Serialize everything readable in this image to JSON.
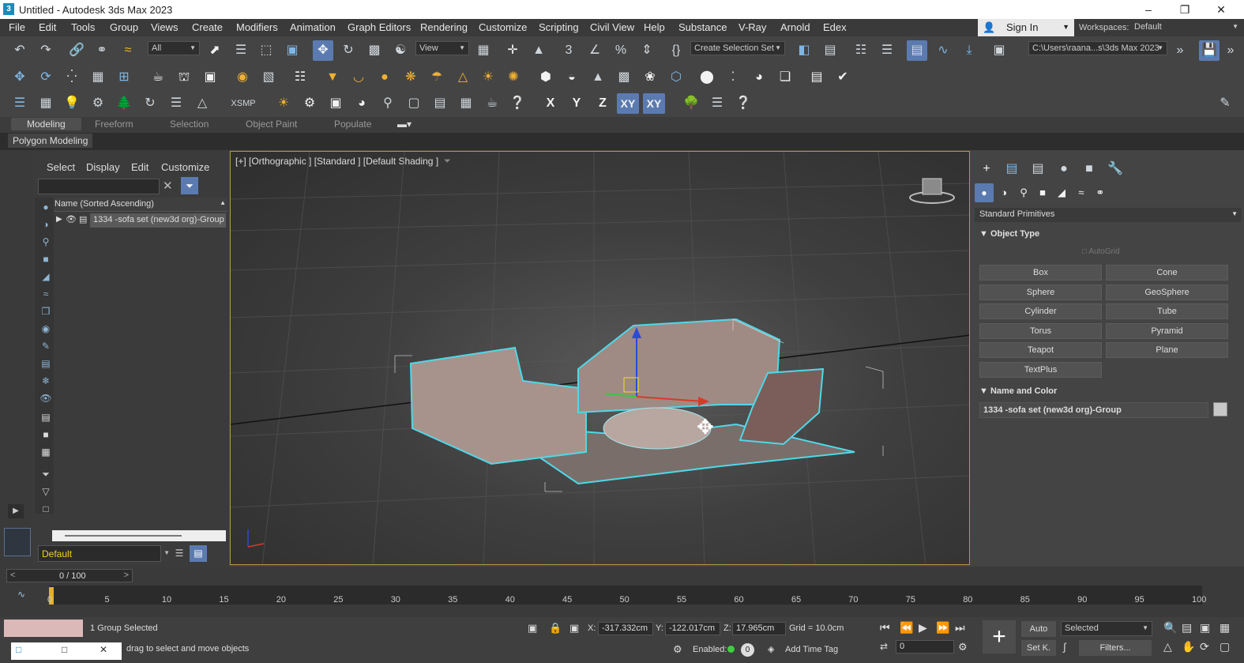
{
  "window": {
    "title": "Untitled - Autodesk 3ds Max 2023",
    "app_icon": "3ds-max-icon",
    "controls": [
      "minimize-icon",
      "maximize-icon",
      "close-icon"
    ]
  },
  "menu": [
    "File",
    "Edit",
    "Tools",
    "Group",
    "Views",
    "Create",
    "Modifiers",
    "Animation",
    "Graph Editors",
    "Rendering",
    "Customize",
    "Scripting",
    "Civil View",
    "Help",
    "Substance",
    "V-Ray",
    "Arnold",
    "Edex"
  ],
  "sign_in": "Sign In",
  "workspaces": {
    "label": "Workspaces:",
    "value": "Default"
  },
  "toolbar1": {
    "filter_value": "All",
    "view_value": "View",
    "selection_set": "Create Selection Set",
    "project_path": "C:\\Users\\raana...s\\3ds Max 2023"
  },
  "toolbar3": {
    "xsmp": "XSMP",
    "x": "X",
    "y": "Y",
    "z": "Z",
    "xy": "XY",
    "xy2": "XY"
  },
  "ribbon_tabs": [
    "Modeling",
    "Freeform",
    "Selection",
    "Object Paint",
    "Populate"
  ],
  "ribbon_active": "Modeling",
  "polygon_modeling": "Polygon Modeling",
  "scene_explorer": {
    "menus": [
      "Select",
      "Display",
      "Edit",
      "Customize"
    ],
    "column_header": "Name (Sorted Ascending)",
    "row": "1334 -sofa set  (new3d org)-Group",
    "layer": "Default"
  },
  "viewport": {
    "label": "[+] [Orthographic ] [Standard ] [Default Shading ]"
  },
  "command_panel": {
    "category": "Standard Primitives",
    "object_type_header": "Object Type",
    "autogrid": "AutoGrid",
    "primitives": [
      "Box",
      "Cone",
      "Sphere",
      "GeoSphere",
      "Cylinder",
      "Tube",
      "Torus",
      "Pyramid",
      "Teapot",
      "Plane",
      "TextPlus"
    ],
    "name_color_header": "Name and Color",
    "object_name": "1334 -sofa set  (new3d org)-Group"
  },
  "timeline": {
    "frame_counter": "0 / 100",
    "ticks": [
      "0",
      "5",
      "10",
      "15",
      "20",
      "25",
      "30",
      "35",
      "40",
      "45",
      "50",
      "55",
      "60",
      "65",
      "70",
      "75",
      "80",
      "85",
      "90",
      "95",
      "100"
    ]
  },
  "status": {
    "selection": "1 Group Selected",
    "prompt": "drag to select and move objects",
    "x_label": "X:",
    "x_value": "-317.332cm",
    "y_label": "Y:",
    "y_value": "-122.017cm",
    "z_label": "Z:",
    "z_value": "17.965cm",
    "grid": "Grid = 10.0cm",
    "enabled": "Enabled:",
    "enabled_value": "0",
    "add_time_tag": "Add Time Tag",
    "auto": "Auto",
    "key_mode": "Selected",
    "set_key": "Set K.",
    "filters": "Filters...",
    "frame": "0"
  },
  "colors": {
    "accent": "#5b7bb0",
    "selection_outline": "#4fd8e8",
    "viewport_border": "#b29a3e"
  }
}
